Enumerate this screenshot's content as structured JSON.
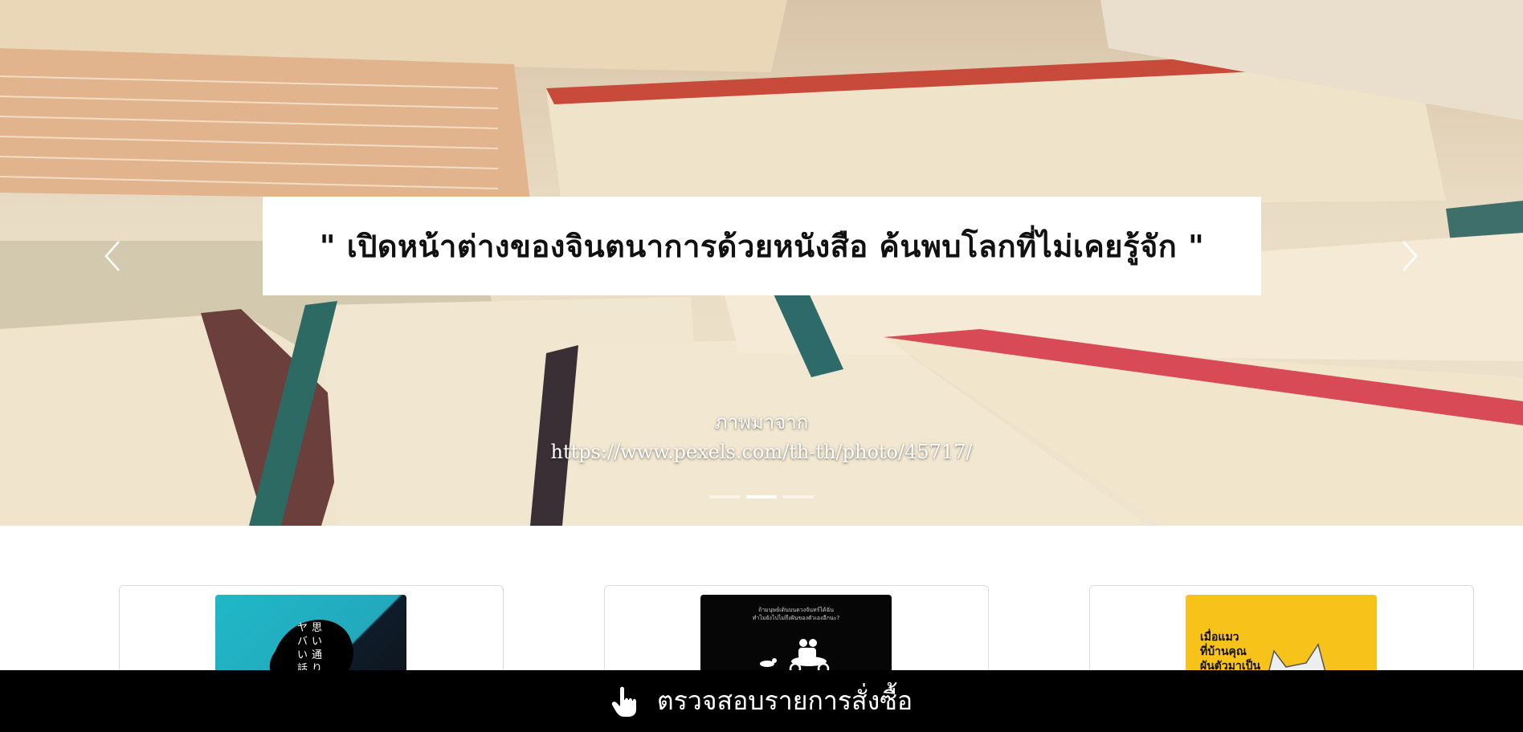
{
  "hero": {
    "caption": "\" เปิดหน้าต่างของจินตนาการด้วยหนังสือ ค้นพบโลกที่ไม่เคยรู้จัก \"",
    "credit_line_1": "ภาพมาจาก",
    "credit_line_2": "https://www.pexels.com/th-th/photo/45717/",
    "slides_total": 3,
    "active_slide": 2,
    "prev_icon": "chevron-left-icon",
    "next_icon": "chevron-right-icon"
  },
  "books": [
    {
      "cover_icon": "book-cover-image",
      "cover_color": "#1fb8c8"
    },
    {
      "cover_icon": "book-cover-image",
      "cover_color": "#060606",
      "cover_text": "ถ้ามนุษย์เดินบนดวงจันทร์ได้ฉัน\nทำไมยังไปไม่ถึงฝันของตัวเองอีกนะ?"
    },
    {
      "cover_icon": "book-cover-image",
      "cover_color": "#f7c21a",
      "cover_text": "เมื่อแมว\nที่บ้านคุณ\nผันตัวมาเป็น"
    }
  ],
  "order_bar": {
    "label": "ตรวจสอบรายการสั่งซื้อ",
    "icon": "pointing-hand-icon",
    "background": "#000000"
  }
}
